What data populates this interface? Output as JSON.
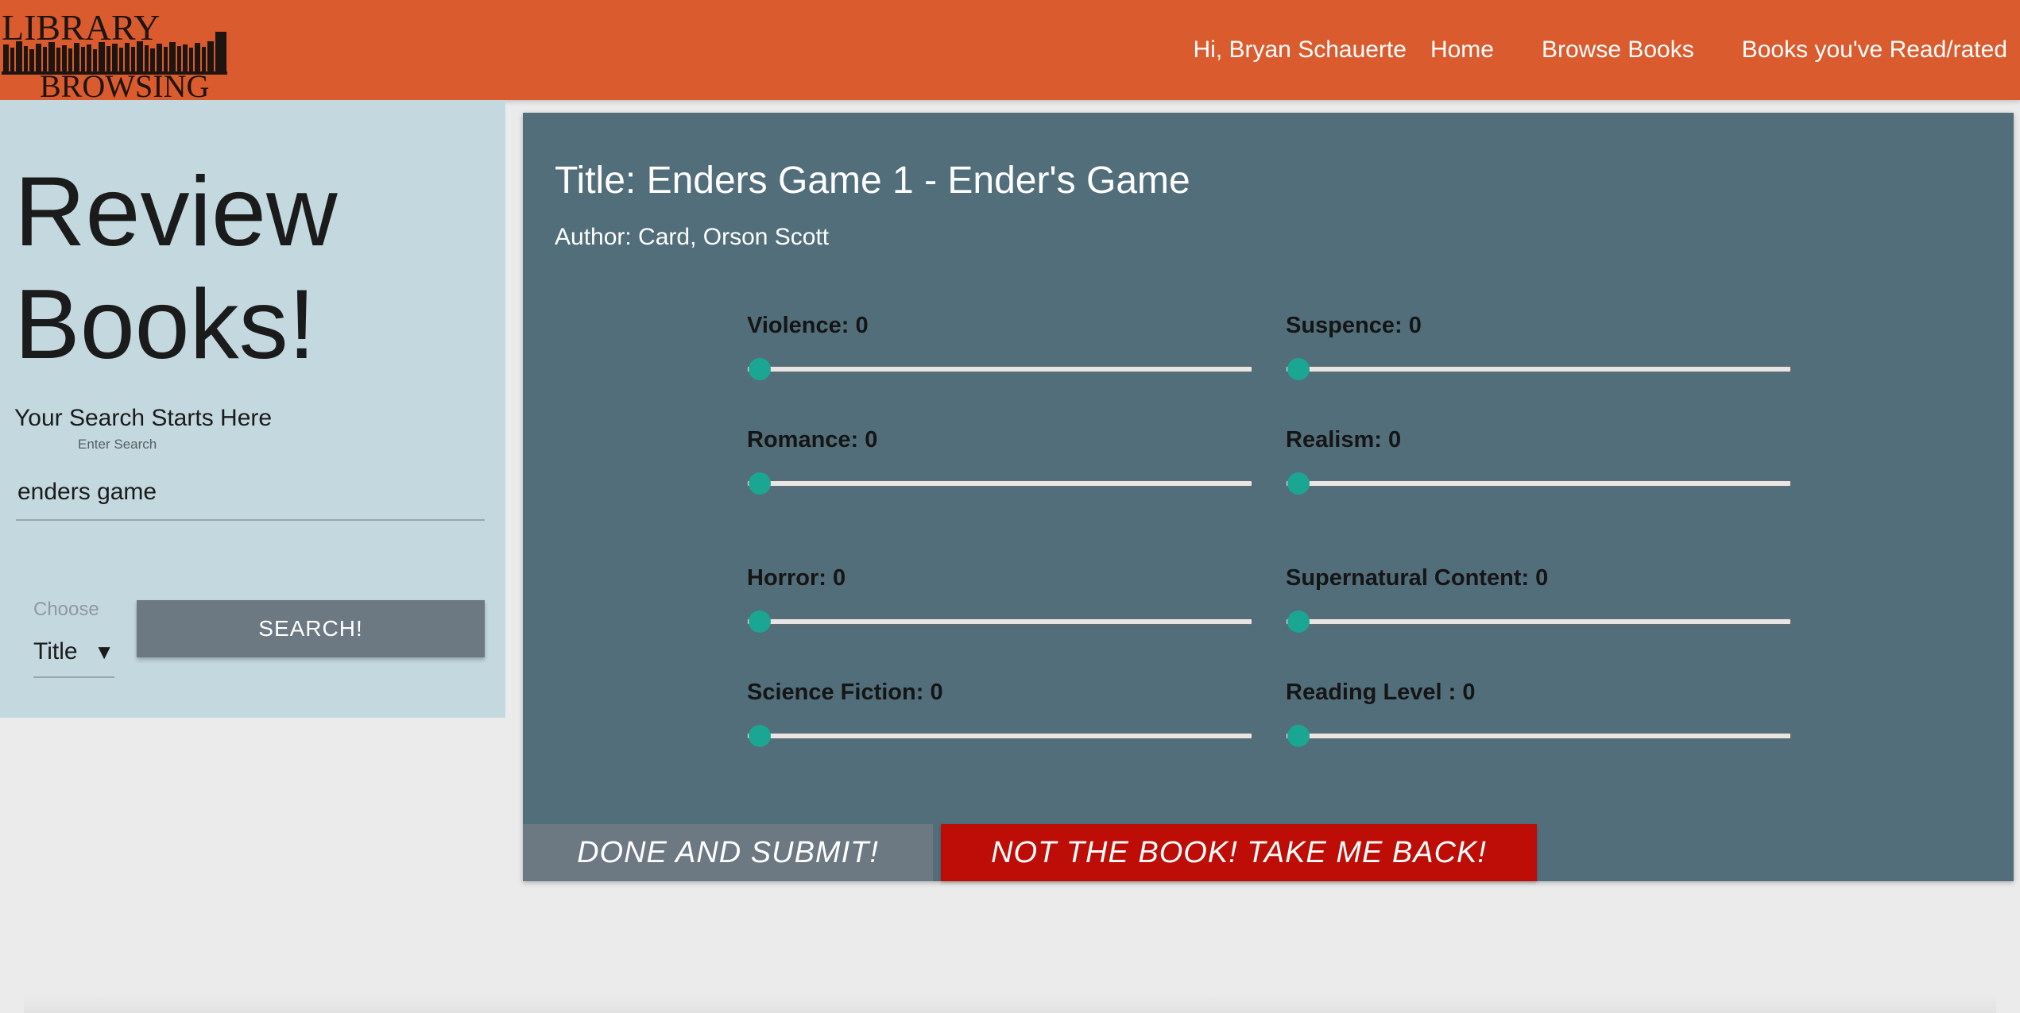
{
  "header": {
    "logo": {
      "line1": "LIBRARY",
      "line2": "BROWSING"
    },
    "greeting": "Hi, Bryan Schauerte",
    "nav": [
      {
        "label": "Home"
      },
      {
        "label": "Browse Books"
      },
      {
        "label": "Books you've Read/rated"
      }
    ]
  },
  "sidebar": {
    "title_line1": "Review",
    "title_line2": "Books!",
    "search_heading": "Your Search Starts Here",
    "search_label": "Enter Search",
    "search_value": "enders game",
    "choose_label": "Choose",
    "choose_value": "Title",
    "search_button": "SEARCH!"
  },
  "book": {
    "title": "Title: Enders Game 1 - Ender's Game",
    "author": "Author: Card, Orson Scott"
  },
  "sliders": [
    {
      "label": "Violence: 0",
      "value": 0
    },
    {
      "label": "Suspence: 0",
      "value": 0
    },
    {
      "label": "Romance: 0",
      "value": 0
    },
    {
      "label": "Realism: 0",
      "value": 0
    },
    {
      "label": "Horror: 0",
      "value": 0
    },
    {
      "label": "Supernatural Content: 0",
      "value": 0
    },
    {
      "label": "Science Fiction: 0",
      "value": 0
    },
    {
      "label": "Reading Level : 0",
      "value": 0
    }
  ],
  "actions": {
    "submit": "DONE AND SUBMIT!",
    "back": "NOT THE BOOK! TAKE ME BACK!"
  },
  "colors": {
    "header": "#da5b2d",
    "sidebar": "#c4d8e0",
    "panel": "#526e7b",
    "slider_thumb": "#1ba694",
    "back_button": "#bd0d06",
    "grey_button": "#6c7882"
  }
}
